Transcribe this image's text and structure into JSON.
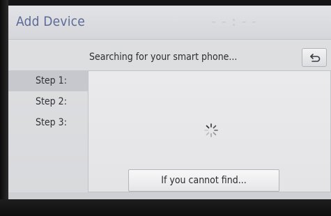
{
  "header": {
    "title": "Add Device",
    "clock": "--:--"
  },
  "content": {
    "subtitle": "Searching for your smart phone...",
    "back_icon": "return-arrow-icon"
  },
  "steps": [
    {
      "label": "Step 1:",
      "active": true
    },
    {
      "label": "Step 2:",
      "active": false
    },
    {
      "label": "Step 3:",
      "active": false
    }
  ],
  "panel": {
    "spinner_icon": "loading-spinner-icon",
    "find_button_label": "If you cannot find..."
  },
  "colors": {
    "title": "#5b6a96",
    "screen_background": "#dfe0e2",
    "active_step": "#c7c8cd"
  }
}
